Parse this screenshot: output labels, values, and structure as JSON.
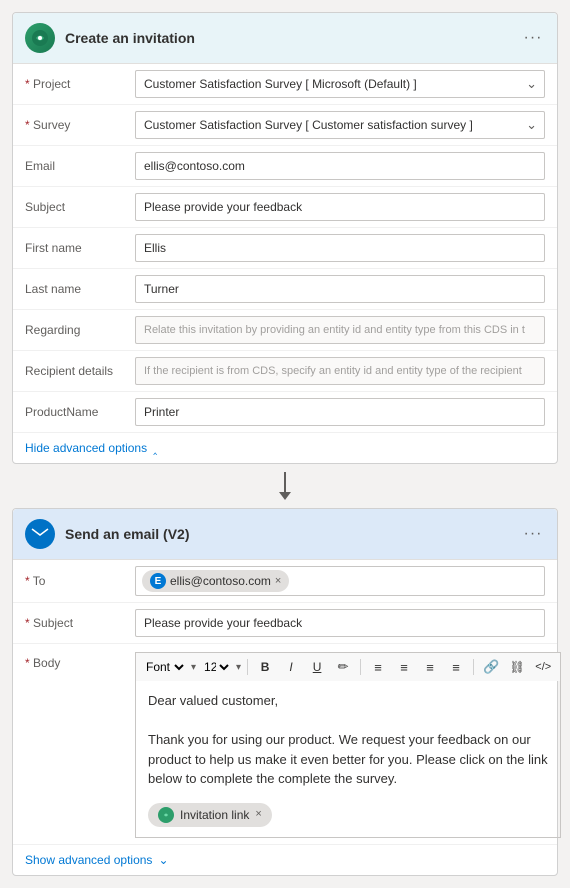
{
  "survey_card": {
    "title": "Create an invitation",
    "icon_label": "survey-icon",
    "fields": [
      {
        "label": "Project",
        "required": true,
        "type": "dropdown",
        "value": "Customer Satisfaction Survey [ Microsoft (Default) ]"
      },
      {
        "label": "Survey",
        "required": true,
        "type": "dropdown",
        "value": "Customer Satisfaction Survey [ Customer satisfaction survey ]"
      },
      {
        "label": "Email",
        "required": false,
        "type": "input",
        "value": "ellis@contoso.com"
      },
      {
        "label": "Subject",
        "required": false,
        "type": "input",
        "value": "Please provide your feedback"
      },
      {
        "label": "First name",
        "required": false,
        "type": "input",
        "value": "Ellis"
      },
      {
        "label": "Last name",
        "required": false,
        "type": "input",
        "value": "Turner"
      },
      {
        "label": "Regarding",
        "required": false,
        "type": "input",
        "value": "Relate this invitation by providing an entity id and entity type from this CDS in t"
      },
      {
        "label": "Recipient details",
        "required": false,
        "type": "input",
        "value": "If the recipient is from CDS, specify an entity id and entity type of the recipient"
      },
      {
        "label": "ProductName",
        "required": false,
        "type": "input",
        "value": "Printer"
      }
    ],
    "advanced_toggle": "Hide advanced options",
    "chevron_direction": "up"
  },
  "email_card": {
    "title": "Send an email (V2)",
    "icon_label": "email-icon",
    "to_email": "ellis@contoso.com",
    "to_email_initial": "E",
    "subject": "Please provide your feedback",
    "body_line1": "Dear valued customer,",
    "body_line2": "Thank you for using our product. We request your feedback on our product to help us make it even better for you. Please click on the link below to complete the complete the survey.",
    "invitation_link_label": "Invitation link",
    "font_value": "Font",
    "font_size_value": "12",
    "toolbar_buttons": [
      "B",
      "I",
      "U",
      "✏",
      "≡",
      "≡",
      "≡",
      "≡",
      "🔗",
      "⛓",
      "</>"
    ],
    "advanced_toggle": "Show advanced options",
    "chevron_direction": "down"
  },
  "dots_menu": "···"
}
